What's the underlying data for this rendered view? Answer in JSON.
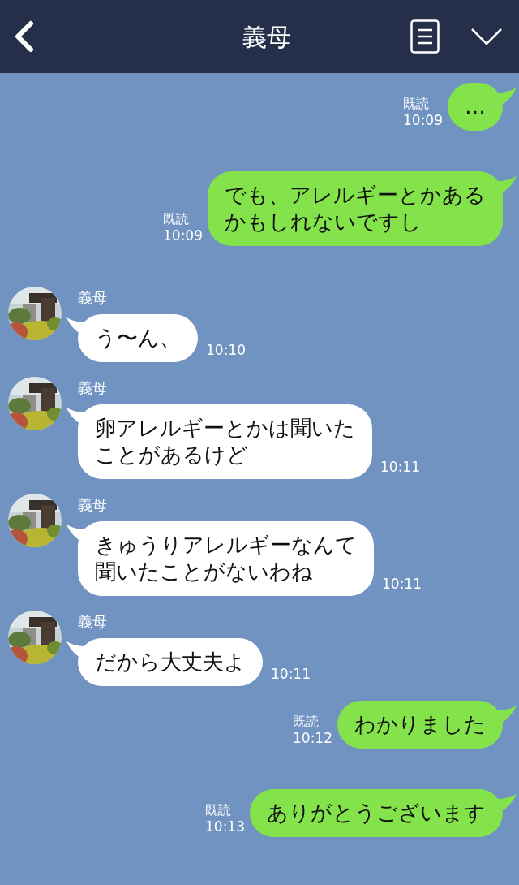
{
  "header": {
    "title": "義母"
  },
  "messages": [
    {
      "kind": "sent",
      "lines": [
        "…"
      ],
      "read": "既読",
      "time": "10:09"
    },
    {
      "kind": "sent",
      "lines": [
        "でも、アレルギーとかある",
        "かもしれないですし"
      ],
      "read": "既読",
      "time": "10:09"
    },
    {
      "kind": "received",
      "name": "義母",
      "lines": [
        "う〜ん、"
      ],
      "time": "10:10"
    },
    {
      "kind": "received",
      "name": "義母",
      "lines": [
        "卵アレルギーとかは聞いた",
        "ことがあるけど"
      ],
      "time": "10:11"
    },
    {
      "kind": "received",
      "name": "義母",
      "lines": [
        "きゅうりアレルギーなんて",
        "聞いたことがないわね"
      ],
      "time": "10:11"
    },
    {
      "kind": "received",
      "name": "義母",
      "lines": [
        "だから大丈夫よ"
      ],
      "time": "10:11"
    },
    {
      "kind": "sent",
      "lines": [
        "わかりました"
      ],
      "read": "既読",
      "time": "10:12"
    },
    {
      "kind": "sent",
      "lines": [
        "ありがとうございます"
      ],
      "read": "既読",
      "time": "10:13"
    }
  ]
}
